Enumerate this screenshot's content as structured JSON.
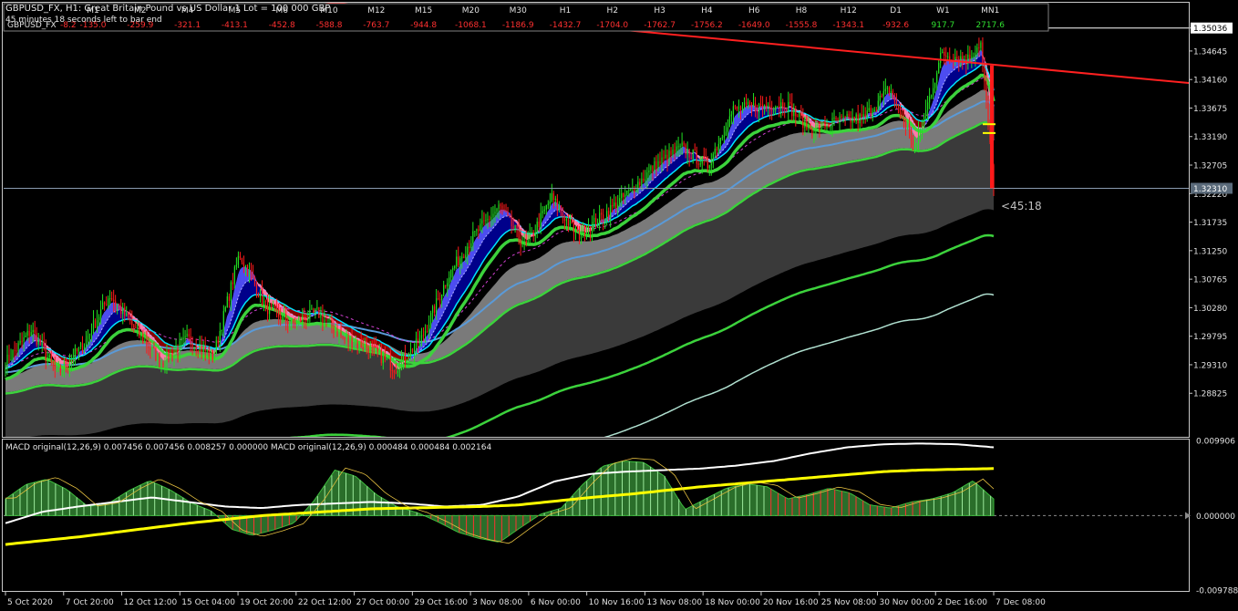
{
  "header": {
    "title": "GBPUSD_FX, H1:  Great Britain Pound vs US Dollar 1 Lot = 100 000 GBP",
    "subtitle": "45 minutes 18 seconds left to bar end"
  },
  "timeframe_panel": {
    "symbol": "GBPUSD_FX",
    "symbol_value": "-8.2",
    "columns": [
      {
        "tf": "M1",
        "value": "-135.0"
      },
      {
        "tf": "M2",
        "value": "-259.9"
      },
      {
        "tf": "M4",
        "value": "-321.1"
      },
      {
        "tf": "M5",
        "value": "-413.1"
      },
      {
        "tf": "M6",
        "value": "-452.8"
      },
      {
        "tf": "M10",
        "value": "-588.8"
      },
      {
        "tf": "M12",
        "value": "-763.7"
      },
      {
        "tf": "M15",
        "value": "-944.8"
      },
      {
        "tf": "M20",
        "value": "-1068.1"
      },
      {
        "tf": "M30",
        "value": "-1186.9"
      },
      {
        "tf": "H1",
        "value": "-1432.7"
      },
      {
        "tf": "H2",
        "value": "-1704.0"
      },
      {
        "tf": "H3",
        "value": "-1762.7"
      },
      {
        "tf": "H4",
        "value": "-1756.2"
      },
      {
        "tf": "H6",
        "value": "-1649.0"
      },
      {
        "tf": "H8",
        "value": "-1555.8"
      },
      {
        "tf": "H12",
        "value": "-1343.1"
      },
      {
        "tf": "D1",
        "value": "-932.6"
      },
      {
        "tf": "W1",
        "value": "917.7"
      },
      {
        "tf": "MN1",
        "value": "2717.6"
      }
    ]
  },
  "countdown": "<45:18",
  "macd_label": "MACD original(12,26,9) 0.007456 0.007456 0.008257 0.000000 MACD original(12,26,9) 0.000484 0.000484 0.002164",
  "colors": {
    "bull": "#22e022",
    "bear": "#ff1a1a",
    "cloud_bull": "#00008b",
    "cloud_bear": "#8b0000",
    "trendline": "#ff2020",
    "ma_fast": "#00e5ff",
    "ma_green": "#3cd23c",
    "macd_line": "#ffff00"
  },
  "chart_data": [
    {
      "type": "candlestick",
      "title": "GBPUSD_FX, H1",
      "yticks": [
        "1.35036",
        "1.34645",
        "1.34160",
        "1.33675",
        "1.33190",
        "1.32705",
        "1.32220",
        "1.31735",
        "1.31250",
        "1.30765",
        "1.30280",
        "1.29795",
        "1.29310",
        "1.28825"
      ],
      "ylim": [
        1.281,
        1.3545
      ],
      "current_price": "1.32310",
      "current_price_value": 1.3231,
      "high_marker": "1.35036",
      "xticks": [
        "5 Oct 2020",
        "7 Oct 20:00",
        "12 Oct 12:00",
        "15 Oct 04:00",
        "19 Oct 20:00",
        "22 Oct 12:00",
        "27 Oct 00:00",
        "29 Oct 16:00",
        "3 Nov 08:00",
        "6 Nov 00:00",
        "10 Nov 16:00",
        "13 Nov 08:00",
        "18 Nov 00:00",
        "20 Nov 16:00",
        "25 Nov 08:00",
        "30 Nov 00:00",
        "2 Dec 16:00",
        "7 Dec 08:00"
      ],
      "close_path": [
        [
          0,
          1.2935
        ],
        [
          2,
          1.299
        ],
        [
          4,
          1.2915
        ],
        [
          6,
          1.2965
        ],
        [
          8,
          1.305
        ],
        [
          10,
          1.299
        ],
        [
          12,
          1.2935
        ],
        [
          14,
          1.2975
        ],
        [
          16,
          1.2945
        ],
        [
          18,
          1.312
        ],
        [
          20,
          1.303
        ],
        [
          22,
          1.3
        ],
        [
          24,
          1.302
        ],
        [
          26,
          1.2975
        ],
        [
          28,
          1.296
        ],
        [
          30,
          1.2925
        ],
        [
          32,
          1.2975
        ],
        [
          34,
          1.308
        ],
        [
          36,
          1.315
        ],
        [
          38,
          1.32
        ],
        [
          40,
          1.313
        ],
        [
          42,
          1.3215
        ],
        [
          44,
          1.315
        ],
        [
          46,
          1.3185
        ],
        [
          48,
          1.3225
        ],
        [
          50,
          1.327
        ],
        [
          52,
          1.33
        ],
        [
          54,
          1.327
        ],
        [
          56,
          1.3365
        ],
        [
          58,
          1.337
        ],
        [
          60,
          1.3375
        ],
        [
          62,
          1.333
        ],
        [
          64,
          1.3345
        ],
        [
          66,
          1.335
        ],
        [
          68,
          1.34
        ],
        [
          70,
          1.33
        ],
        [
          72,
          1.346
        ],
        [
          74,
          1.345
        ],
        [
          75,
          1.348
        ],
        [
          76,
          1.3231
        ]
      ]
    },
    {
      "type": "macd",
      "title": "MACD original(12,26,9)",
      "yticks": [
        "0.009906",
        "0.000000",
        "-0.009788"
      ],
      "ylim": [
        -0.0098,
        0.0099
      ],
      "histogram": [
        0.0022,
        0.0041,
        0.0048,
        0.0034,
        0.0012,
        0.0016,
        0.0033,
        0.0046,
        0.0034,
        0.0017,
        0.0006,
        -0.0018,
        -0.0026,
        -0.0019,
        -0.001,
        0.002,
        0.006,
        0.0052,
        0.0028,
        0.0012,
        0.0004,
        -0.0008,
        -0.0022,
        -0.003,
        -0.0035,
        -0.0016,
        0.0002,
        0.001,
        0.004,
        0.0065,
        0.0072,
        0.007,
        0.0052,
        0.0008,
        0.0022,
        0.0036,
        0.0042,
        0.0038,
        0.0022,
        0.0028,
        0.0036,
        0.003,
        0.0014,
        0.001,
        0.0018,
        0.0022,
        0.003,
        0.0046,
        0.0022
      ],
      "hist_red_from": 37,
      "signal": [
        -0.0038,
        -0.0033,
        -0.0028,
        -0.0022,
        -0.0016,
        -0.001,
        -0.0005,
        0.0,
        0.0003,
        0.0006,
        0.0009,
        0.001,
        0.0011,
        0.0012,
        0.0014,
        0.0019,
        0.0024,
        0.0028,
        0.0033,
        0.0038,
        0.0042,
        0.0046,
        0.005,
        0.0054,
        0.0058,
        0.006,
        0.0061,
        0.0062
      ],
      "macd": [
        -0.001,
        0.0005,
        0.0012,
        0.0018,
        0.0024,
        0.0018,
        0.0012,
        0.001,
        0.0014,
        0.0016,
        0.0018,
        0.0016,
        0.0012,
        0.0014,
        0.0025,
        0.0045,
        0.0055,
        0.0058,
        0.006,
        0.0062,
        0.0066,
        0.0072,
        0.0082,
        0.009,
        0.0094,
        0.0095,
        0.0094,
        0.009
      ]
    }
  ]
}
